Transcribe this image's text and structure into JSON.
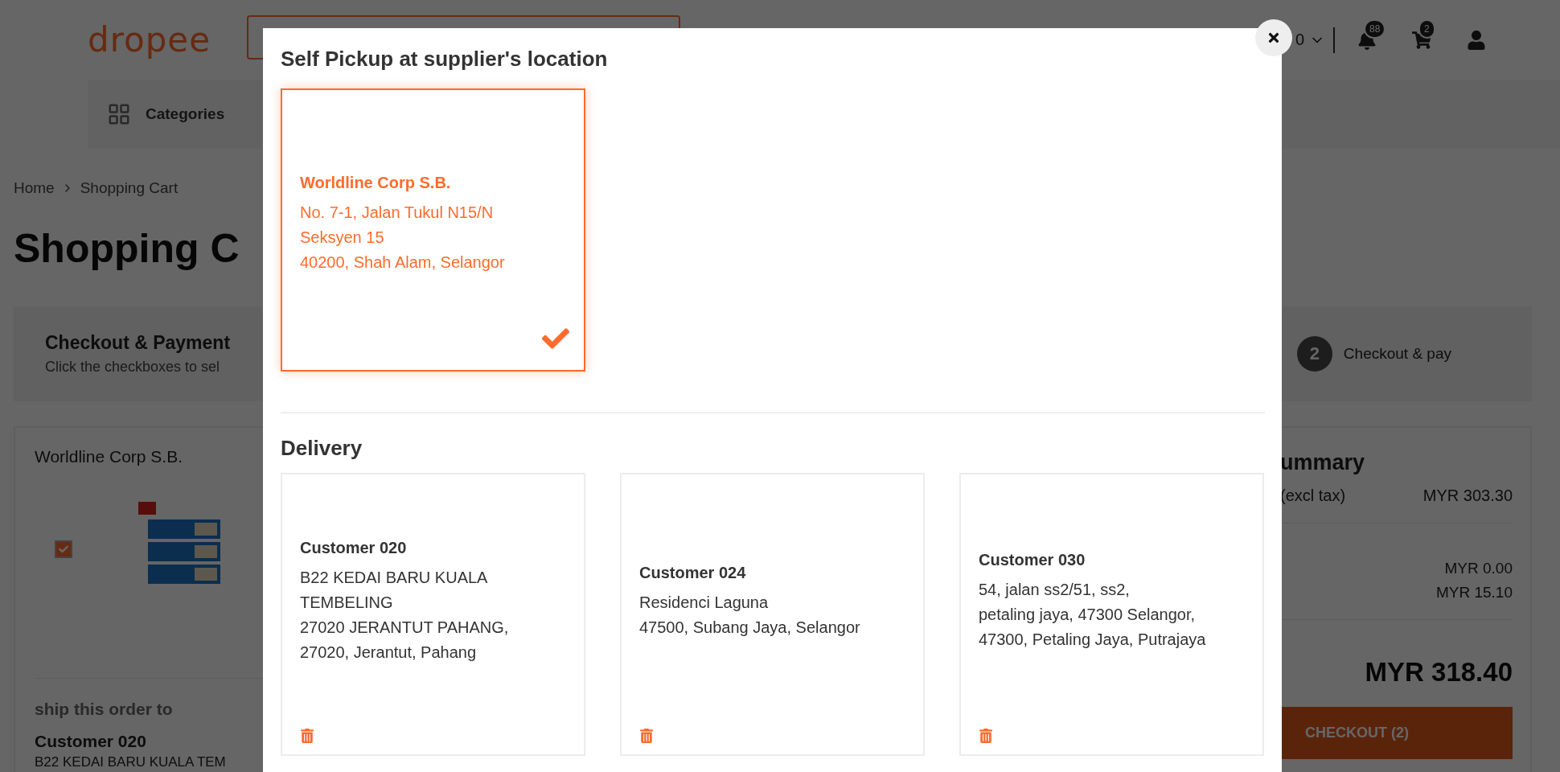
{
  "header": {
    "logo": "dropee",
    "currency": "0",
    "notifications_badge": "88",
    "cart_badge": "2"
  },
  "nav": {
    "categories": "Categories"
  },
  "breadcrumb": [
    "Home",
    "Shopping Cart"
  ],
  "page_title": "Shopping C",
  "checkout_banner": {
    "title": "Checkout & Payment",
    "subtitle": "Click the checkboxes to sel",
    "step_number": "2",
    "step_label": "Checkout & pay"
  },
  "cart": {
    "supplier": "Worldline Corp S.B.",
    "items": [
      {
        "checked": true,
        "kind": "picture"
      }
    ],
    "ship_to_label": "ship this order to",
    "ship_to_name": "Customer 020",
    "ship_to_address": "B22 KEDAI BARU KUALA TEM"
  },
  "summary": {
    "title": "ummary",
    "subtotal_label": "(excl tax)",
    "subtotal": "MYR 303.30",
    "fees": [
      "MYR 0.00",
      "MYR 15.10"
    ],
    "total": "MYR 318.40",
    "checkout_button": "CHECKOUT (2)"
  },
  "modal": {
    "pickup_title": "Self Pickup at supplier's location",
    "pickup_options": [
      {
        "name": "Worldline Corp S.B.",
        "address_lines": [
          "No. 7-1, Jalan Tukul N15/N",
          "Seksyen 15",
          "40200, Shah Alam, Selangor"
        ],
        "selected": true
      }
    ],
    "delivery_title": "Delivery",
    "delivery_options": [
      {
        "name": "Customer 020",
        "address_lines": [
          "B22 KEDAI BARU KUALA TEMBELING",
          "27020 JERANTUT PAHANG,",
          "27020, Jerantut, Pahang"
        ],
        "selected": false
      },
      {
        "name": "Customer 024",
        "address_lines": [
          "Residenci Laguna",
          "47500, Subang Jaya, Selangor"
        ],
        "selected": false
      },
      {
        "name": "Customer 030",
        "address_lines": [
          "54, jalan ss2/51, ss2,",
          "petaling jaya, 47300 Selangor,",
          "47300, Petaling Jaya, Putrajaya"
        ],
        "selected": false
      }
    ]
  }
}
